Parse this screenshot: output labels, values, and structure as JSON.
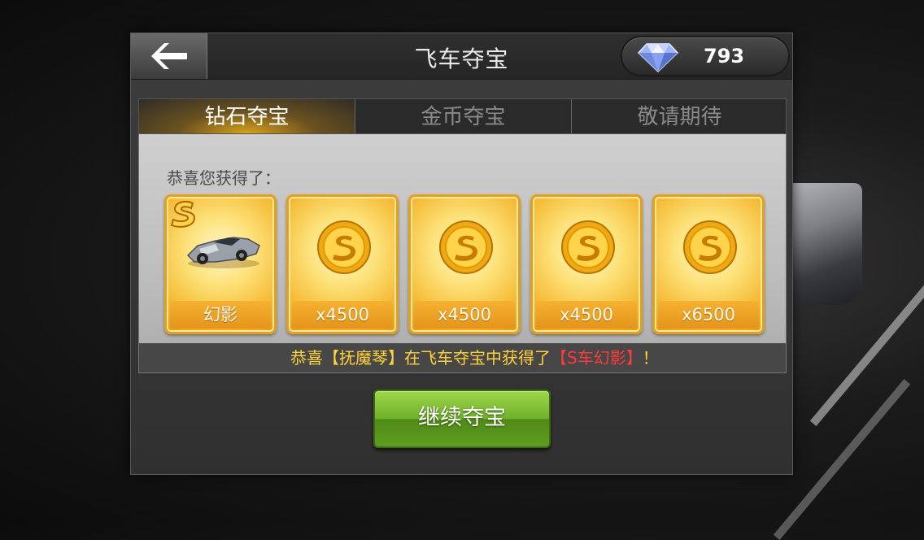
{
  "header": {
    "title": "飞车夺宝",
    "diamond_count": "793"
  },
  "tabs": [
    {
      "label": "钻石夺宝",
      "active": true
    },
    {
      "label": "金币夺宝",
      "active": false
    },
    {
      "label": "敬请期待",
      "active": false
    }
  ],
  "rewards": {
    "congrats_text": "恭喜您获得了：",
    "items": [
      {
        "icon": "car-icon",
        "label": "幻影"
      },
      {
        "icon": "coin-icon",
        "label": "x4500"
      },
      {
        "icon": "coin-icon",
        "label": "x4500"
      },
      {
        "icon": "coin-icon",
        "label": "x4500"
      },
      {
        "icon": "coin-icon",
        "label": "x6500"
      }
    ]
  },
  "ticker": {
    "p1": "恭喜【抚魔琴】在飞车夺宝中获得了",
    "p2": "【S车幻影】",
    "p3": "！"
  },
  "continue_label": "继续夺宝",
  "colors": {
    "gold": "#f4b72f",
    "green": "#6fb12a",
    "ticker_yellow": "#ffd23a",
    "ticker_red": "#ff3a3a"
  }
}
